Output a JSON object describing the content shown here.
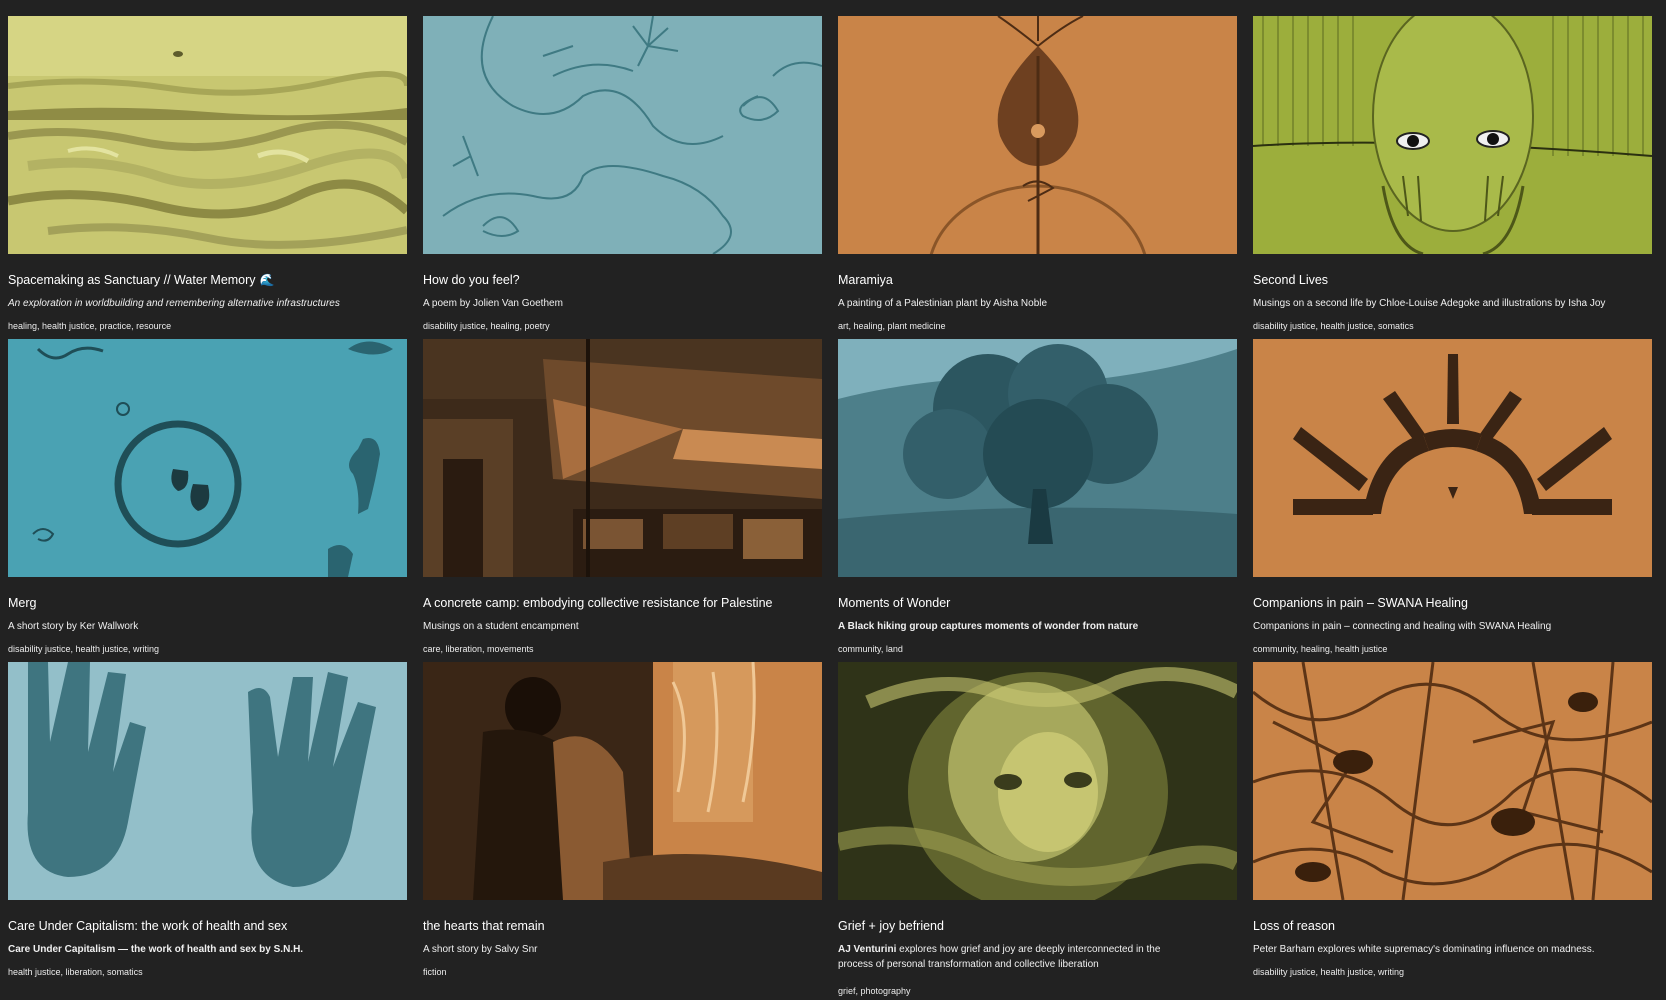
{
  "colors": {
    "background": "#222222",
    "yellow": "#c8c771",
    "blue": "#7fb0b8",
    "orange": "#c98448",
    "olive": "#9cae3c",
    "teal": "#4aa2b3"
  },
  "cards": [
    {
      "title": "Spacemaking as Sanctuary // Water Memory",
      "title_emoji": "🌊",
      "description": "An exploration in worldbuilding and remembering alternative infrastructures",
      "tags": "healing, health justice, practice, resource",
      "image": "yellow-painted-seascape"
    },
    {
      "title": "How do you feel?",
      "description": "A poem by Jolien Van Goethem",
      "tags": "disability justice, healing, poetry",
      "image": "blue-line-drawing-flowers"
    },
    {
      "title": "Maramiya",
      "description": "A painting of a Palestinian plant by Aisha Noble",
      "tags": "art, healing, plant medicine",
      "image": "orange-plant-bulb-painting"
    },
    {
      "title": "Second Lives",
      "description": "Musings on a second life by Chloe-Louise Adegoke and illustrations by Isha Joy",
      "tags": "disability justice, health justice, somatics",
      "image": "olive-face-illustration"
    },
    {
      "title": "Merg",
      "description": "A short story by Ker Wallwork",
      "tags": "disability justice, health justice, writing",
      "image": "teal-circle-jugs-figures"
    },
    {
      "title": "A concrete camp: embodying collective resistance for Palestine",
      "description": "Musings on a student encampment",
      "tags": "care, liberation, movements",
      "image": "orange-encampment-flag-photo"
    },
    {
      "title": "Moments of Wonder",
      "description": "A Black hiking group captures moments of wonder from nature",
      "tags": "community, land",
      "image": "blue-tree-hillside-photo"
    },
    {
      "title": "Companions in pain – SWANA Healing",
      "description": "Companions in pain – connecting and healing with SWANA Healing",
      "tags": "community, healing, health justice",
      "image": "orange-sun-brushstroke"
    },
    {
      "title": "Care Under Capitalism: the work of health and sex",
      "description": "Care Under Capitalism — the work of health and sex by S.N.H.",
      "tags": "health justice, liberation, somatics",
      "image": "blue-hands-photo"
    },
    {
      "title": "the hearts that remain",
      "description": "A short story by Salvy Snr",
      "tags": "fiction",
      "image": "orange-hugging-figures-photo"
    },
    {
      "title": "Grief + joy befriend",
      "description_strong": "AJ Venturini",
      "description": " explores how grief and joy are deeply interconnected in the process of personal transformation and collective liberation",
      "tags": "grief, photography",
      "image": "yellow-blurred-face-photo"
    },
    {
      "title": "Loss of reason",
      "description": "Peter Barham explores white supremacy's dominating influence on madness.",
      "tags": "disability justice, health justice, writing",
      "image": "orange-abstract-texture"
    }
  ]
}
